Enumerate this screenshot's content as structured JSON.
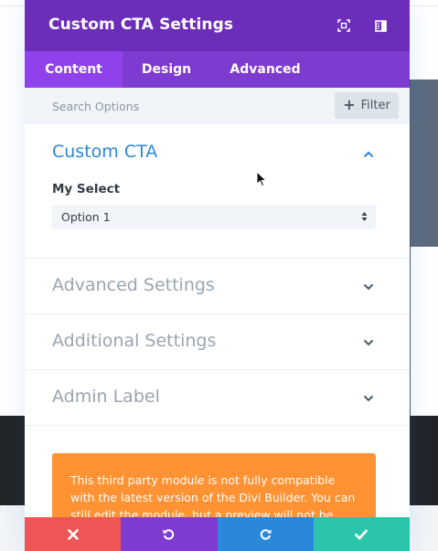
{
  "modal": {
    "title": "Custom CTA Settings"
  },
  "tabs": [
    {
      "label": "Content",
      "active": true
    },
    {
      "label": "Design",
      "active": false
    },
    {
      "label": "Advanced",
      "active": false
    }
  ],
  "search": {
    "placeholder": "Search Options",
    "filter_label": "Filter"
  },
  "sections": [
    {
      "title": "Custom CTA",
      "open": true
    },
    {
      "title": "Advanced Settings",
      "open": false
    },
    {
      "title": "Additional Settings",
      "open": false
    },
    {
      "title": "Admin Label",
      "open": false
    }
  ],
  "custom_cta": {
    "field_label": "My Select",
    "select_value": "Option 1"
  },
  "warning": {
    "text": "This third party module is not fully compatible with the latest version of the Divi Builder. You can still edit the module, but a preview will not be"
  },
  "icons": {
    "fullscreen": "expand-icon",
    "sidebar": "sidebar-toggle-icon",
    "discard": "close-icon",
    "undo": "undo-icon",
    "redo": "redo-icon",
    "save": "check-icon"
  },
  "colors": {
    "header": "#6c2eb9",
    "tabs": "#7e3bd0",
    "active_tab": "#8f42ec",
    "accent": "#2b87da",
    "warning": "#ff9232",
    "discard": "#ef5555",
    "undo": "#7e3bd0",
    "redo": "#2b87da",
    "save": "#29c4a9"
  }
}
